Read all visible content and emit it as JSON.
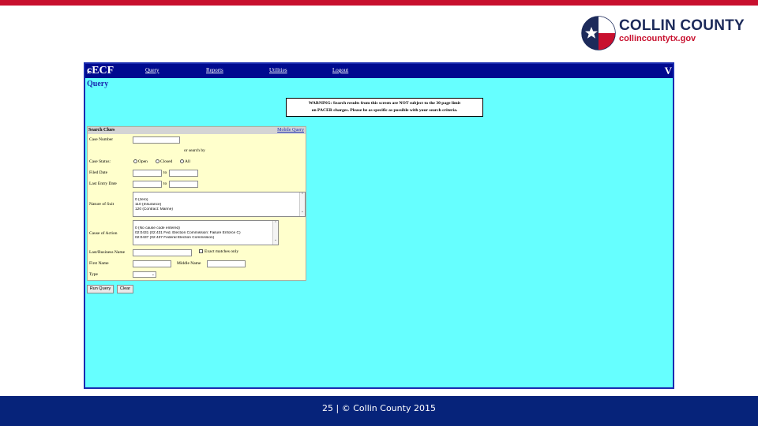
{
  "logo": {
    "title": "COLLIN COUNTY",
    "url": "collincountytx.gov",
    "colors": {
      "navy": "#1c2a5a",
      "red": "#c8102e"
    }
  },
  "ecf": {
    "logo": "ECF",
    "menu": [
      "Query",
      "Reports",
      "Utilities",
      "Logout"
    ],
    "bar_end": "V",
    "page_title": "Query",
    "warning": {
      "line1": "WARNING: Search results from this screen are NOT subject to the 30 page limit",
      "line2": "on PACER charges. Please be as specific as possible with your search criteria."
    },
    "form": {
      "header": "Search Clues",
      "mobile_query": "Mobile Query",
      "case_number_label": "Case Number",
      "or_search_by": "or search by",
      "case_status_label": "Case Status:",
      "status_options": [
        "Open",
        "Closed",
        "All"
      ],
      "filed_date_label": "Filed Date",
      "to_label": "to",
      "last_entry_label": "Last Entry Date",
      "nature_label": "Nature of Suit",
      "nature_options": [
        "0 (zero)",
        "110 (Insurance)",
        "120 (Contract: Marine)"
      ],
      "cause_label": "Cause of Action",
      "cause_options": [
        "0 (No cause code entered)",
        "02:0431 (02:431 Fed. Election Commission: Failure Enforce C)",
        "02:0437 (02:437 Federal Election Commission)"
      ],
      "last_name_label": "Last/Business Name",
      "exact_matches": "Exact matches only",
      "first_name_label": "First Name",
      "middle_name_label": "Middle Name",
      "type_label": "Type"
    },
    "buttons": {
      "run_query": "Run Query",
      "clear": "Clear"
    }
  },
  "footer": {
    "text": "25 | © Collin County 2015"
  },
  "colors": {
    "ecf_background": "#66ffff",
    "ecf_bar": "#000a8f",
    "form_background": "#ffffcc",
    "footer": "#06237a",
    "top_stripe": "#c8102e"
  }
}
